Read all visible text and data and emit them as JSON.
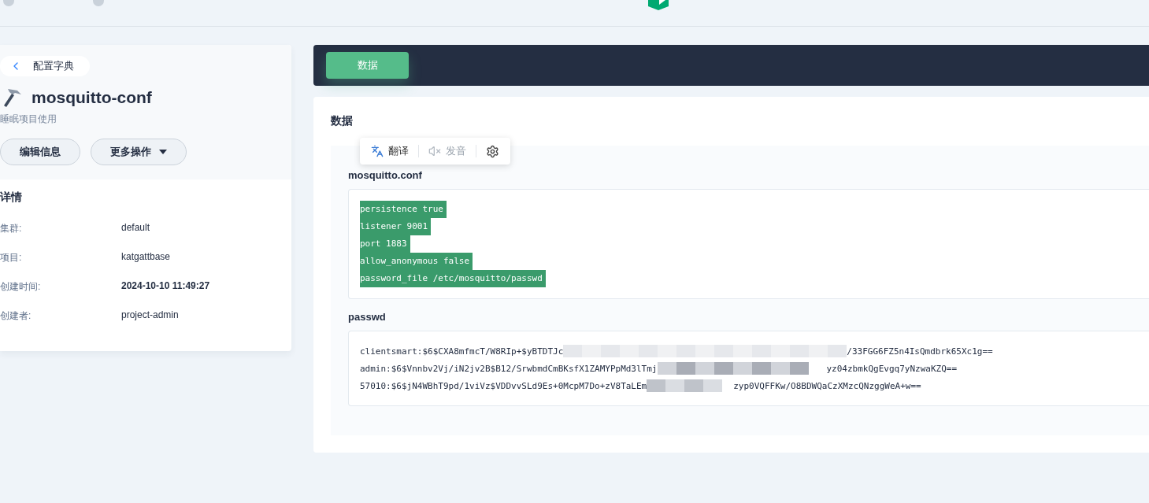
{
  "back_link": {
    "label": "配置字典"
  },
  "resource": {
    "name": "mosquitto-conf",
    "description": "睡眠项目使用"
  },
  "actions": [
    {
      "label": "编辑信息",
      "kind": "button"
    },
    {
      "label": "更多操作",
      "kind": "dropdown"
    }
  ],
  "details": {
    "title": "详情",
    "fields": [
      {
        "label": "集群:",
        "value": "default"
      },
      {
        "label": "项目:",
        "value": "katgattbase"
      },
      {
        "label": "创建时间:",
        "value": "2024-10-10 11:49:27"
      },
      {
        "label": "创建者:",
        "value": "project-admin"
      }
    ]
  },
  "tabs": [
    {
      "label": "数据",
      "selected": true
    }
  ],
  "data_panel": {
    "title": "数据",
    "entries": [
      {
        "key": "mosquitto.conf",
        "selected": true,
        "lines": [
          "persistence true",
          "listener 9001",
          "port 1883",
          "allow_anonymous false",
          "password_file /etc/mosquitto/passwd"
        ]
      },
      {
        "key": "passwd",
        "selected": false,
        "masked_lines": [
          {
            "start": "clientsmart:$6$CXA8mfmcT/W8RIp+$yBTDTJc",
            "end": "/33FGG6FZ5n4IsQmdbrk65Xc1g=="
          },
          {
            "start": "admin:$6$Vnnbv2Vj/iN2jv2B$B12/SrwbmdCmBKsfX1ZAMYPpMd3lTmj",
            "end": "yz04zbmkQgEvgq7yNzwaKZQ=="
          },
          {
            "start": "57010:$6$jN4WBhT9pd/1viVz$VDDvvSLd9Es+0McpM7Do+zV8TaLEm",
            "end": "zyp0VQFFKw/O8BDWQaCzXMzcQNzggWeA+w=="
          }
        ]
      }
    ]
  },
  "translate_popup": {
    "items": [
      {
        "label": "翻译",
        "disabled": false
      },
      {
        "label": "发音",
        "disabled": true
      }
    ]
  }
}
